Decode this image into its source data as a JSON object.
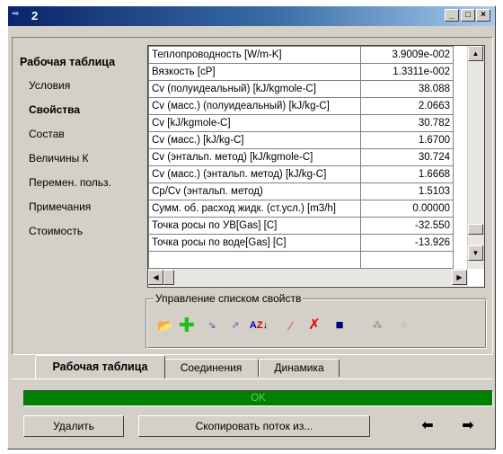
{
  "window": {
    "title": "2"
  },
  "sidebar": {
    "title": "Рабочая таблица",
    "items": [
      {
        "label": "Условия"
      },
      {
        "label": "Свойства",
        "active": true
      },
      {
        "label": "Состав"
      },
      {
        "label": "Величины К"
      },
      {
        "label": "Перемен. польз."
      },
      {
        "label": "Примечания"
      },
      {
        "label": "Стоимость"
      }
    ]
  },
  "properties": {
    "rows": [
      {
        "name": "Теплопроводность [W/m-K]",
        "value": "3.9009e-002"
      },
      {
        "name": "Вязкость [cP]",
        "value": "1.3311e-002"
      },
      {
        "name": "Cv (полуидеальный) [kJ/kgmole-C]",
        "value": "38.088"
      },
      {
        "name": "Cv (масс.) (полуидеальный) [kJ/kg-C]",
        "value": "2.0663"
      },
      {
        "name": "Cv [kJ/kgmole-C]",
        "value": "30.782"
      },
      {
        "name": "Cv (масс.) [kJ/kg-C]",
        "value": "1.6700"
      },
      {
        "name": "Cv (энтальп. метод) [kJ/kgmole-C]",
        "value": "30.724"
      },
      {
        "name": "Cv (масс.) (энтальп. метод) [kJ/kg-C]",
        "value": "1.6668"
      },
      {
        "name": "Cp/Cv (энтальп. метод)",
        "value": "1.5103"
      },
      {
        "name": "Сумм. об. расход жидк. (ст.усл.) [m3/h]",
        "value": "0.00000"
      },
      {
        "name": "Точка росы по УВ[Gas] [C]",
        "value": "-32.550"
      },
      {
        "name": "Точка росы по воде[Gas] [C]",
        "value": "-13.926"
      },
      {
        "name": "",
        "value": ""
      }
    ]
  },
  "property_list": {
    "label": "Управление списком свойств"
  },
  "tabs": [
    {
      "label": "Рабочая таблица",
      "active": true
    },
    {
      "label": "Соединения"
    },
    {
      "label": "Динамика"
    }
  ],
  "status": {
    "text": "OK",
    "color": "#008000"
  },
  "buttons": {
    "delete": "Удалить",
    "copy_stream": "Скопировать поток из..."
  }
}
